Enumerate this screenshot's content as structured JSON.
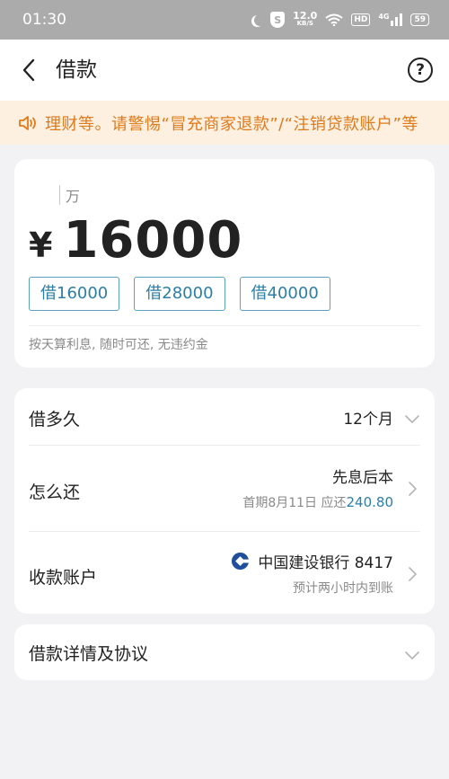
{
  "status_bar": {
    "time": "01:30",
    "net_speed_value": "12.0",
    "net_speed_unit": "KB/S",
    "shield_label": "S",
    "hd_label": "HD",
    "signal_label": "4G",
    "battery": "59"
  },
  "header": {
    "title": "借款",
    "help_label": "?"
  },
  "notice": {
    "text": "理财等。请警惕“冒充商家退款”/“注销贷款账户”等"
  },
  "amount": {
    "unit": "万",
    "currency": "¥",
    "value": "16000",
    "quick_options": [
      "借16000",
      "借28000",
      "借40000"
    ],
    "note": "按天算利息, 随时可还, 无违约金"
  },
  "term": {
    "label": "借多久",
    "value": "12个月"
  },
  "repay": {
    "label": "怎么还",
    "method": "先息后本",
    "first_due_prefix": "首期8月11日 应还",
    "first_due_amount": "240.80"
  },
  "account": {
    "label": "收款账户",
    "bank": "中国建设银行 8417",
    "arrival": "预计两小时内到账"
  },
  "details": {
    "label": "借款详情及协议"
  },
  "colors": {
    "accent": "#2b7ea7",
    "notice_text": "#e07a1c",
    "notice_bg": "#fdf0e0",
    "bank_logo": "#1f4e9c"
  }
}
